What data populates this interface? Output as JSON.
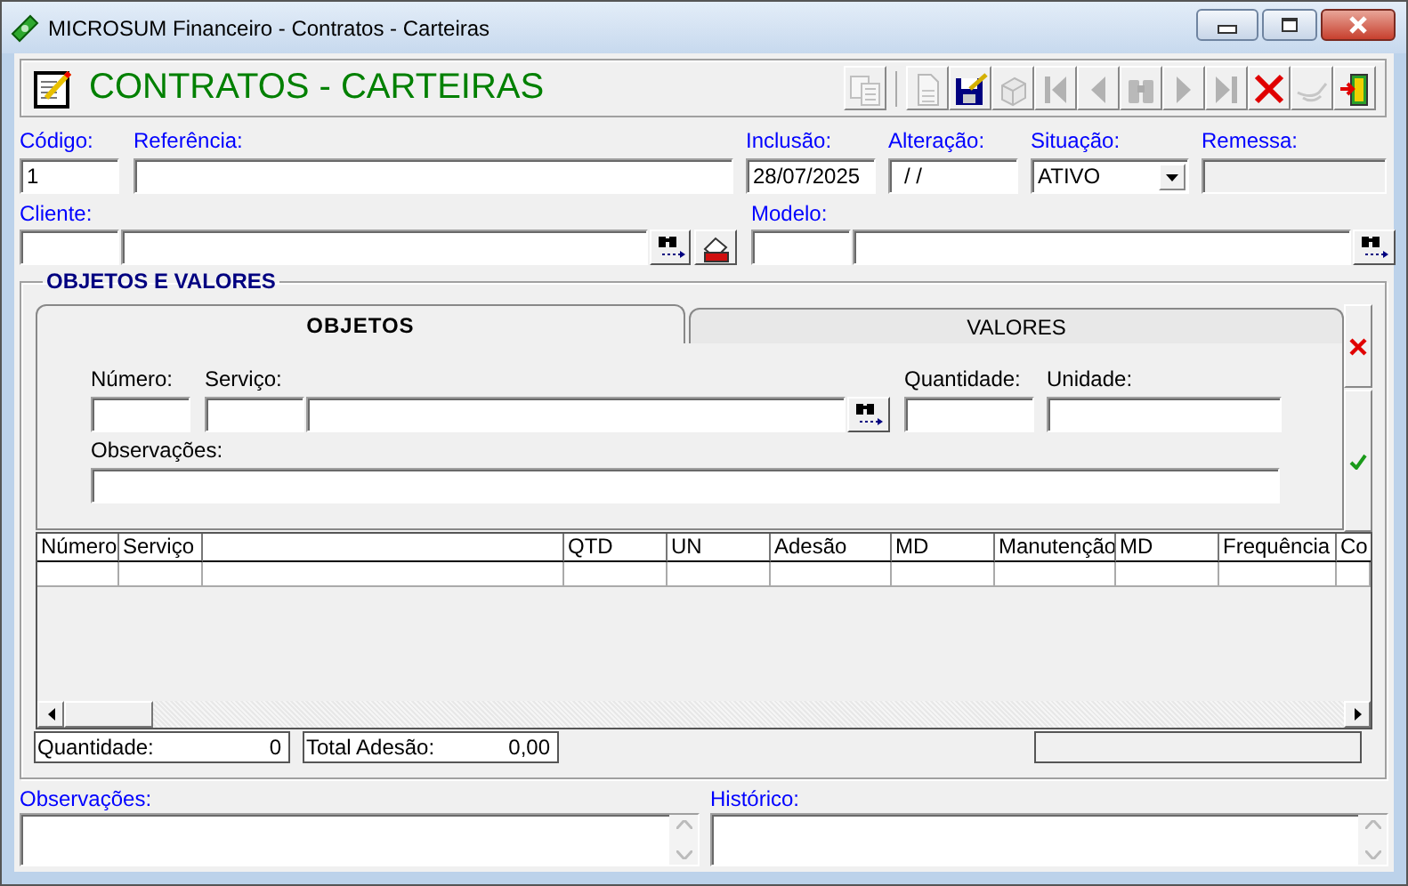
{
  "window": {
    "title": "MICROSUM Financeiro - Contratos - Carteiras"
  },
  "header": {
    "title": "CONTRATOS - CARTEIRAS"
  },
  "toolbar": {
    "groups": [
      [
        {
          "kind": "copy",
          "disabled": true
        }
      ],
      [
        {
          "kind": "new",
          "disabled": true
        },
        {
          "kind": "save",
          "disabled": false
        },
        {
          "kind": "delete",
          "disabled": true
        },
        {
          "kind": "first",
          "disabled": true
        },
        {
          "kind": "prev",
          "disabled": true
        },
        {
          "kind": "search",
          "disabled": true
        },
        {
          "kind": "next",
          "disabled": true
        },
        {
          "kind": "last",
          "disabled": true
        },
        {
          "kind": "cancel",
          "disabled": false
        },
        {
          "kind": "confirm",
          "disabled": true
        },
        {
          "kind": "exit",
          "disabled": false
        }
      ]
    ]
  },
  "row_1": [
    {
      "label": "Código:",
      "value": "1",
      "kind": "text",
      "disabled": false
    },
    {
      "label": "Referência:",
      "kind": "text",
      "disabled": false
    },
    {
      "label": "Inclusão:",
      "value": "28/07/2025",
      "kind": "text",
      "disabled": false
    },
    {
      "label": "Alteração:",
      "value": "/ /",
      "kind": "text",
      "disabled": false
    },
    {
      "label": "Situação:",
      "value": "ATIVO",
      "kind": "select",
      "disabled": false
    },
    {
      "label": "Remessa:",
      "kind": "text",
      "disabled": true
    }
  ],
  "row_2": [
    {
      "label": "Cliente:",
      "buttons": [
        {
          "kind": "lookup"
        },
        {
          "kind": "clear"
        }
      ]
    },
    {
      "label": "Modelo:",
      "buttons": [
        {
          "kind": "lookup"
        }
      ]
    }
  ],
  "group": {
    "title": "OBJETOS E VALORES",
    "tabs": [
      {
        "label": "OBJETOS",
        "selected": true
      },
      {
        "label": "VALORES",
        "selected": false
      }
    ],
    "fields": [
      {
        "label": "Número:"
      },
      {
        "label": "Serviço:"
      },
      {
        "label": "Quantidade:"
      },
      {
        "label": "Unidade:"
      },
      {
        "label": "Observações:"
      }
    ],
    "table": {
      "columns": [
        "Número",
        "Serviço",
        "QTD",
        "UN",
        "Adesão",
        "MD",
        "Manutenção",
        "MD",
        "Frequência",
        "Co"
      ]
    },
    "totals": [
      {
        "label": "Quantidade:",
        "value": "0"
      },
      {
        "label": "Total Adesão:",
        "value": "0,00"
      }
    ]
  },
  "notes": [
    {
      "label": "Observações:"
    },
    {
      "label": "Histórico:"
    }
  ]
}
